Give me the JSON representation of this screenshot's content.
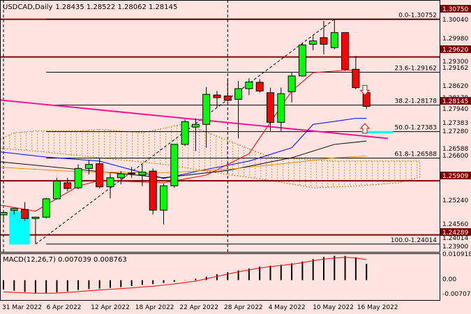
{
  "header": {
    "symbol": "USDCAD",
    "timeframe": "Daily",
    "ohlc": "1.28435 1.28522 1.28062 1.28145"
  },
  "macd_label": "MACD(12,26,7) 0.007039 0.008763",
  "colors": {
    "background": "#ffe4e1",
    "bull_candle": "#00ff00",
    "bear_candle": "#ff0000",
    "resistance_line": "#800000",
    "trend_line": "#ff1493",
    "fib_line": "#000000",
    "ma_blue": "#0000ff",
    "ma_red": "#ff0000",
    "ma_black": "#000000",
    "ma_orange": "#ff8c00",
    "ichimoku": "#b8860b",
    "highlight": "#00ffff",
    "macd_signal": "#ff0000"
  },
  "chart_data": [
    {
      "type": "candlestick",
      "title": "USDCAD,Daily",
      "x_labels": [
        "31 Mar 2022",
        "6 Apr 2022",
        "12 Apr 2022",
        "18 Apr 2022",
        "22 Apr 2022",
        "28 Apr 2022",
        "4 May 2022",
        "10 May 2022",
        "16 May 2022"
      ],
      "y_ticks": [
        "1.30750",
        "1.30040",
        "1.29980",
        "1.29620",
        "1.29300",
        "1.29162",
        "1.28620",
        "1.28178",
        "1.28145",
        "1.27940",
        "1.27383",
        "1.27280",
        "1.26588",
        "1.26600",
        "1.25909",
        "1.25240",
        "1.24560",
        "1.24289",
        "1.24014",
        "1.23900"
      ],
      "ylim": [
        1.238,
        1.3095
      ],
      "candles": [
        {
          "date": "2022-03-30",
          "open": 1.2489,
          "high": 1.2502,
          "low": 1.2468,
          "close": 1.2496
        },
        {
          "date": "2022-03-31",
          "open": 1.2502,
          "high": 1.251,
          "low": 1.249,
          "close": 1.2508
        },
        {
          "date": "2022-04-01",
          "open": 1.2505,
          "high": 1.2527,
          "low": 1.247,
          "close": 1.2478
        },
        {
          "date": "2022-04-04",
          "open": 1.2478,
          "high": 1.2483,
          "low": 1.2403,
          "close": 1.2482
        },
        {
          "date": "2022-04-05",
          "open": 1.2482,
          "high": 1.254,
          "low": 1.2478,
          "close": 1.2537
        },
        {
          "date": "2022-04-06",
          "open": 1.2537,
          "high": 1.26,
          "low": 1.2535,
          "close": 1.259
        },
        {
          "date": "2022-04-07",
          "open": 1.2585,
          "high": 1.26,
          "low": 1.256,
          "close": 1.2568
        },
        {
          "date": "2022-04-08",
          "open": 1.257,
          "high": 1.264,
          "low": 1.2566,
          "close": 1.2628
        },
        {
          "date": "2022-04-11",
          "open": 1.2628,
          "high": 1.2654,
          "low": 1.261,
          "close": 1.264
        },
        {
          "date": "2022-04-12",
          "open": 1.2642,
          "high": 1.266,
          "low": 1.2568,
          "close": 1.2573
        },
        {
          "date": "2022-04-13",
          "open": 1.2573,
          "high": 1.2615,
          "low": 1.2538,
          "close": 1.26
        },
        {
          "date": "2022-04-14",
          "open": 1.26,
          "high": 1.262,
          "low": 1.258,
          "close": 1.2612
        },
        {
          "date": "2022-04-15",
          "open": 1.2612,
          "high": 1.2632,
          "low": 1.26,
          "close": 1.2614
        },
        {
          "date": "2022-04-18",
          "open": 1.2608,
          "high": 1.264,
          "low": 1.2575,
          "close": 1.2617
        },
        {
          "date": "2022-04-19",
          "open": 1.262,
          "high": 1.2628,
          "low": 1.249,
          "close": 1.2503
        },
        {
          "date": "2022-04-20",
          "open": 1.2503,
          "high": 1.2582,
          "low": 1.246,
          "close": 1.2576
        },
        {
          "date": "2022-04-21",
          "open": 1.2576,
          "high": 1.27,
          "low": 1.257,
          "close": 1.27
        },
        {
          "date": "2022-04-22",
          "open": 1.27,
          "high": 1.2775,
          "low": 1.2695,
          "close": 1.2768
        },
        {
          "date": "2022-04-25",
          "open": 1.2752,
          "high": 1.2778,
          "low": 1.268,
          "close": 1.276
        },
        {
          "date": "2022-04-26",
          "open": 1.276,
          "high": 1.2872,
          "low": 1.269,
          "close": 1.285
        },
        {
          "date": "2022-04-27",
          "open": 1.2848,
          "high": 1.286,
          "low": 1.281,
          "close": 1.284
        },
        {
          "date": "2022-04-28",
          "open": 1.2845,
          "high": 1.2895,
          "low": 1.2825,
          "close": 1.2832
        },
        {
          "date": "2022-04-29",
          "open": 1.2835,
          "high": 1.289,
          "low": 1.2718,
          "close": 1.2867
        },
        {
          "date": "2022-05-02",
          "open": 1.2867,
          "high": 1.2898,
          "low": 1.2848,
          "close": 1.2887
        },
        {
          "date": "2022-05-03",
          "open": 1.2886,
          "high": 1.2895,
          "low": 1.2855,
          "close": 1.286
        },
        {
          "date": "2022-05-04",
          "open": 1.2855,
          "high": 1.287,
          "low": 1.274,
          "close": 1.2766
        },
        {
          "date": "2022-05-05",
          "open": 1.2766,
          "high": 1.287,
          "low": 1.274,
          "close": 1.2852
        },
        {
          "date": "2022-05-06",
          "open": 1.2858,
          "high": 1.2915,
          "low": 1.2826,
          "close": 1.2905
        },
        {
          "date": "2022-05-09",
          "open": 1.2905,
          "high": 1.3005,
          "low": 1.2903,
          "close": 1.2998
        },
        {
          "date": "2022-05-10",
          "open": 1.3,
          "high": 1.3025,
          "low": 1.2982,
          "close": 1.301
        },
        {
          "date": "2022-05-11",
          "open": 1.302,
          "high": 1.307,
          "low": 1.297,
          "close": 1.3
        },
        {
          "date": "2022-05-12",
          "open": 1.299,
          "high": 1.3075,
          "low": 1.2985,
          "close": 1.3035
        },
        {
          "date": "2022-05-13",
          "open": 1.3035,
          "high": 1.3035,
          "low": 1.292,
          "close": 1.2925
        },
        {
          "date": "2022-05-16",
          "open": 1.2925,
          "high": 1.2965,
          "low": 1.2865,
          "close": 1.287
        },
        {
          "date": "2022-05-17",
          "open": 1.2855,
          "high": 1.2852,
          "low": 1.2806,
          "close": 1.2814
        }
      ],
      "horizontal_levels": [
        {
          "price": 1.3075,
          "kind": "resistance"
        },
        {
          "price": 1.2962,
          "kind": "resistance"
        },
        {
          "price": 1.25909,
          "kind": "support"
        },
        {
          "price": 1.24289,
          "kind": "support"
        }
      ],
      "fibonacci_levels": [
        {
          "label": "0.0-1.30752",
          "price": 1.30752
        },
        {
          "label": "23.6-1.29162",
          "price": 1.29162
        },
        {
          "label": "38.2-1.28178",
          "price": 1.28178
        },
        {
          "label": "50.0-1.27383",
          "price": 1.27383
        },
        {
          "label": "61.8-1.26588",
          "price": 1.26588
        },
        {
          "label": "100.0-1.24014",
          "price": 1.24014
        }
      ],
      "price_labels": [
        {
          "text": "1.30750",
          "highlighted": true
        },
        {
          "text": "1.29620",
          "highlighted": true
        },
        {
          "text": "1.28145",
          "highlighted": true
        },
        {
          "text": "1.25909",
          "highlighted": true
        },
        {
          "text": "1.24289",
          "highlighted": true
        }
      ],
      "trend_line": {
        "start": {
          "date": "2022-03-29",
          "price": 1.2835
        },
        "end": {
          "date": "2022-05-19",
          "price": 1.2718
        }
      },
      "moving_averages": [
        {
          "color": "blue",
          "points": [
            [
              "2022-03-29",
              1.268
            ],
            [
              "2022-04-05",
              1.2662
            ],
            [
              "2022-04-12",
              1.265
            ],
            [
              "2022-04-20",
              1.2598
            ],
            [
              "2022-04-26",
              1.2625
            ],
            [
              "2022-05-02",
              1.265
            ],
            [
              "2022-05-06",
              1.269
            ],
            [
              "2022-05-10",
              1.276
            ],
            [
              "2022-05-16",
              1.2778
            ],
            [
              "2022-05-17",
              1.2778
            ]
          ]
        },
        {
          "color": "red",
          "points": [
            [
              "2022-03-29",
              1.2522
            ],
            [
              "2022-04-04",
              1.25
            ],
            [
              "2022-04-08",
              1.2575
            ],
            [
              "2022-04-12",
              1.2592
            ],
            [
              "2022-04-20",
              1.2585
            ],
            [
              "2022-04-26",
              1.2608
            ],
            [
              "2022-05-02",
              1.2672
            ],
            [
              "2022-05-06",
              1.286
            ],
            [
              "2022-05-10",
              1.2915
            ],
            [
              "2022-05-13",
              1.2922
            ],
            [
              "2022-05-16",
              1.2922
            ]
          ]
        },
        {
          "color": "black",
          "points": [
            [
              "2022-03-29",
              1.265
            ],
            [
              "2022-04-08",
              1.2625
            ],
            [
              "2022-04-20",
              1.26
            ],
            [
              "2022-04-28",
              1.2622
            ],
            [
              "2022-05-06",
              1.266
            ],
            [
              "2022-05-12",
              1.27
            ],
            [
              "2022-05-17",
              1.271
            ]
          ]
        },
        {
          "color": "orange",
          "points": [
            [
              "2022-03-29",
              1.2633
            ],
            [
              "2022-04-08",
              1.2618
            ],
            [
              "2022-04-20",
              1.2615
            ],
            [
              "2022-04-28",
              1.2625
            ],
            [
              "2022-05-06",
              1.2645
            ],
            [
              "2022-05-12",
              1.266
            ],
            [
              "2022-05-17",
              1.2665
            ]
          ]
        }
      ],
      "cloud_upper": [
        [
          "2022-03-29",
          1.2705
        ],
        [
          "2022-03-31",
          1.2735
        ],
        [
          "2022-04-04",
          1.274
        ],
        [
          "2022-04-08",
          1.274
        ],
        [
          "2022-04-12",
          1.2745
        ],
        [
          "2022-04-18",
          1.2735
        ],
        [
          "2022-04-22",
          1.2762
        ],
        [
          "2022-04-28",
          1.2712
        ],
        [
          "2022-05-04",
          1.2662
        ],
        [
          "2022-05-12",
          1.265
        ],
        [
          "2022-05-18",
          1.265
        ],
        [
          "2022-05-24",
          1.265
        ]
      ],
      "cloud_lower": [
        [
          "2022-03-29",
          1.269
        ],
        [
          "2022-04-04",
          1.268
        ],
        [
          "2022-04-12",
          1.266
        ],
        [
          "2022-04-20",
          1.264
        ],
        [
          "2022-04-28",
          1.261
        ],
        [
          "2022-05-04",
          1.2592
        ],
        [
          "2022-05-10",
          1.257
        ],
        [
          "2022-05-16",
          1.2575
        ],
        [
          "2022-05-20",
          1.2585
        ],
        [
          "2022-05-24",
          1.2602
        ]
      ],
      "highlight_boxes": [
        {
          "date_from": "2022-03-31",
          "date_to": "2022-04-01",
          "price_from": 1.24,
          "price_to": 1.25
        },
        {
          "date_from": "2022-05-17",
          "date_to": "2022-05-19",
          "price_from": 1.2733,
          "price_to": 1.274
        }
      ],
      "arrows": [
        {
          "date": "2022-05-16",
          "price": 1.286,
          "direction": "down"
        },
        {
          "date": "2022-05-16",
          "price": 1.275,
          "direction": "up"
        }
      ],
      "vertical_lines": [
        "2022-03-30",
        "2022-04-28"
      ]
    },
    {
      "type": "histogram",
      "title": "MACD(12,26,7)",
      "values_label": "0.007039 0.008763",
      "y_ticks": [
        "0.010918",
        "0.00",
        "-0.00707"
      ],
      "ylim": [
        -0.0085,
        0.0115
      ],
      "macd": [
        -0.004,
        -0.0045,
        -0.005,
        -0.0055,
        -0.0055,
        -0.0052,
        -0.0048,
        -0.0042,
        -0.0038,
        -0.0036,
        -0.0033,
        -0.003,
        -0.0025,
        -0.002,
        -0.0017,
        -0.0012,
        -0.0007,
        -0.0001,
        0.0006,
        0.0015,
        0.0025,
        0.0034,
        0.0042,
        0.005,
        0.0058,
        0.0062,
        0.0066,
        0.0072,
        0.008,
        0.009,
        0.0099,
        0.0104,
        0.0104,
        0.0098,
        0.007
      ],
      "signal": [
        -0.005,
        -0.0052,
        -0.0054,
        -0.0056,
        -0.0056,
        -0.0055,
        -0.0052,
        -0.0049,
        -0.0045,
        -0.0042,
        -0.0039,
        -0.0036,
        -0.0033,
        -0.0029,
        -0.0026,
        -0.0021,
        -0.0016,
        -0.001,
        -0.0004,
        0.0006,
        0.0016,
        0.0026,
        0.0036,
        0.0044,
        0.0052,
        0.0058,
        0.0063,
        0.0068,
        0.0075,
        0.0083,
        0.009,
        0.0095,
        0.0098,
        0.0095,
        0.0088
      ]
    }
  ]
}
